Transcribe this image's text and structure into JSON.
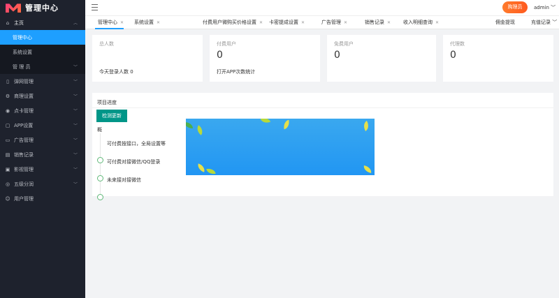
{
  "app": {
    "title": "管理中心"
  },
  "header": {
    "buy_label": "购理员",
    "user_label": "admin"
  },
  "sidebar": {
    "items": [
      {
        "label": "主页",
        "icon": "home-icon",
        "expanded": true,
        "children": [
          {
            "label": "管理中心",
            "active": true
          },
          {
            "label": "系统设置"
          },
          {
            "label": "管 理 员"
          }
        ]
      },
      {
        "label": "弹网管理",
        "icon": "phone-icon"
      },
      {
        "label": "商理设置",
        "icon": "gear-icon"
      },
      {
        "label": "点卡管理",
        "icon": "card-icon"
      },
      {
        "label": "APP设置",
        "icon": "app-icon"
      },
      {
        "label": "广告管理",
        "icon": "ad-icon"
      },
      {
        "label": "销售记录",
        "icon": "record-icon"
      },
      {
        "label": "影视管理",
        "icon": "video-icon"
      },
      {
        "label": "五级分润",
        "icon": "share-icon"
      },
      {
        "label": "用户管理",
        "icon": "user-icon"
      }
    ]
  },
  "tabs": [
    {
      "label": "管理中心",
      "active": true
    },
    {
      "label": "系统设置"
    },
    {
      "label": "付费用户微购买价格设置"
    },
    {
      "label": "卡密提成设置"
    },
    {
      "label": "广告管理"
    },
    {
      "label": "销售记录"
    },
    {
      "label": "收入明细查询"
    },
    {
      "label": "佣金提现"
    },
    {
      "label": "充值记录"
    }
  ],
  "stats": [
    {
      "label": "总人数",
      "value": "",
      "foot": "今天登录人数 0"
    },
    {
      "label": "付费用户",
      "value": "0",
      "foot": "打开APP次数统计"
    },
    {
      "label": "免费用户",
      "value": "0",
      "foot": ""
    },
    {
      "label": "代理数",
      "value": "0",
      "foot": ""
    }
  ],
  "progress": {
    "title": "项目进度",
    "check_button": "检测更新",
    "timeline_label": "概",
    "items": [
      "可付费按接口，全局设置等",
      "可付费对接微信/QQ登录",
      "未来接对接微信"
    ]
  }
}
